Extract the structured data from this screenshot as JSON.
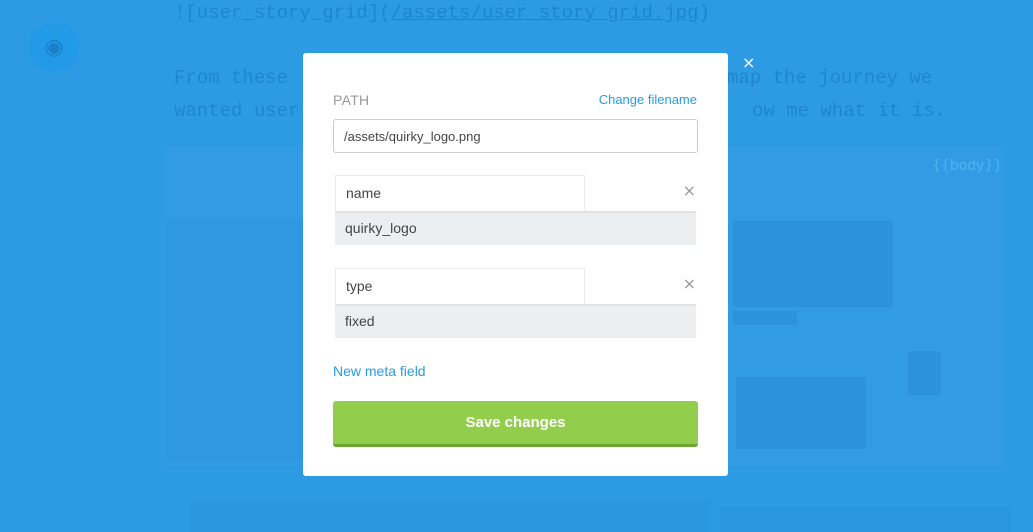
{
  "background": {
    "line1_prefix": "![user_story_grid](",
    "line1_link": "/assets/user_story_grid.jpg",
    "line1_suffix": ")",
    "line2_left": "From these",
    "line2_right": "map the journey we",
    "line3_left": "wanted user",
    "line3_right": "ow me what it is.",
    "body_tag": "{{body}}",
    "globe_icon": "globe-icon"
  },
  "modal": {
    "path_label": "PATH",
    "change_filename": "Change filename",
    "path_value": "/assets/quirky_logo.png",
    "meta_fields": [
      {
        "key": "name",
        "value": "quirky_logo"
      },
      {
        "key": "type",
        "value": "fixed"
      }
    ],
    "remove_icon": "×",
    "new_meta_field": "New meta field",
    "save_label": "Save changes",
    "close_icon": "×"
  },
  "colors": {
    "overlay": "#2d9be4",
    "accent": "#2a9be2",
    "save": "#92cd4b"
  }
}
